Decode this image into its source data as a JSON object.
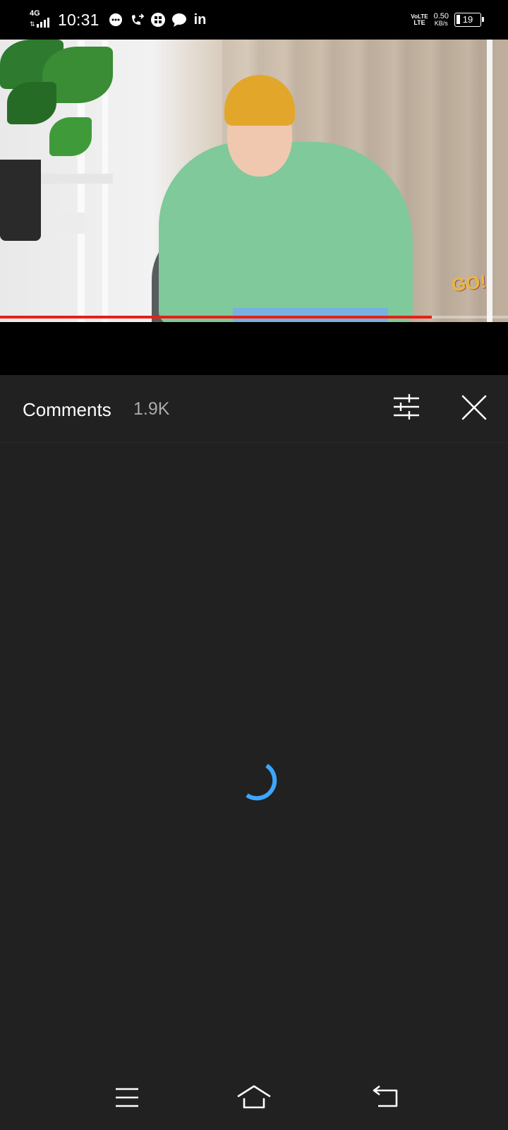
{
  "status_bar": {
    "network": "4G",
    "time": "10:31",
    "volte": "VoLTE",
    "lte": "LTE",
    "speed_value": "0.50",
    "speed_unit": "KB/s",
    "battery": "19",
    "notification_icons": [
      "chat-bubble-icon",
      "call-forward-icon",
      "app-grid-icon",
      "message-icon",
      "linkedin-icon"
    ],
    "linkedin_text": "in"
  },
  "video": {
    "watermark": "GO!",
    "progress_fraction": 0.85,
    "progress_color": "#e62117"
  },
  "comments": {
    "title": "Comments",
    "count": "1.9K",
    "filter_icon": "sliders-icon",
    "close_icon": "close-icon",
    "loading": true,
    "spinner_color": "#3ea6ff"
  },
  "nav_bar": {
    "buttons": [
      "menu-icon",
      "home-icon",
      "back-icon"
    ]
  }
}
